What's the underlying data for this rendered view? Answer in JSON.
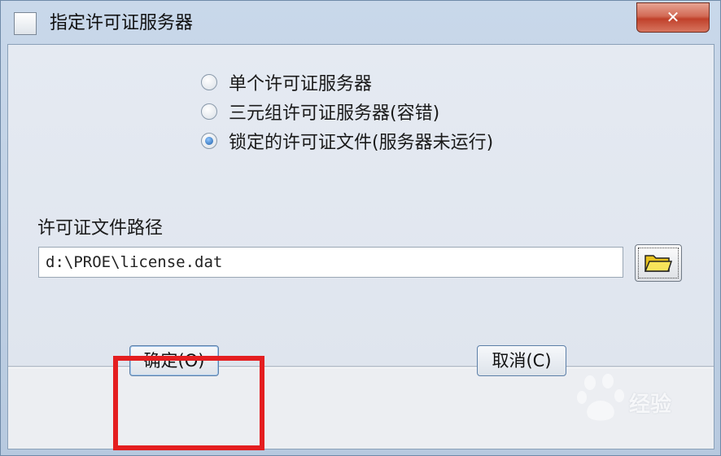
{
  "window": {
    "title": "指定许可证服务器",
    "close_label": "✕"
  },
  "options": [
    {
      "label": "单个许可证服务器",
      "checked": false
    },
    {
      "label": "三元组许可证服务器(容错)",
      "checked": false
    },
    {
      "label": "锁定的许可证文件(服务器未运行)",
      "checked": true
    }
  ],
  "license": {
    "label": "许可证文件路径",
    "path_value": "d:\\PROE\\license.dat",
    "browse_icon": "folder-icon"
  },
  "buttons": {
    "ok_label": "确定(O)",
    "cancel_label": "取消(C)"
  },
  "watermark": {
    "text": "经验"
  },
  "colors": {
    "highlight": "#e41e20",
    "close_button": "#c0412b",
    "radio_checked": "#1f5fa8"
  }
}
